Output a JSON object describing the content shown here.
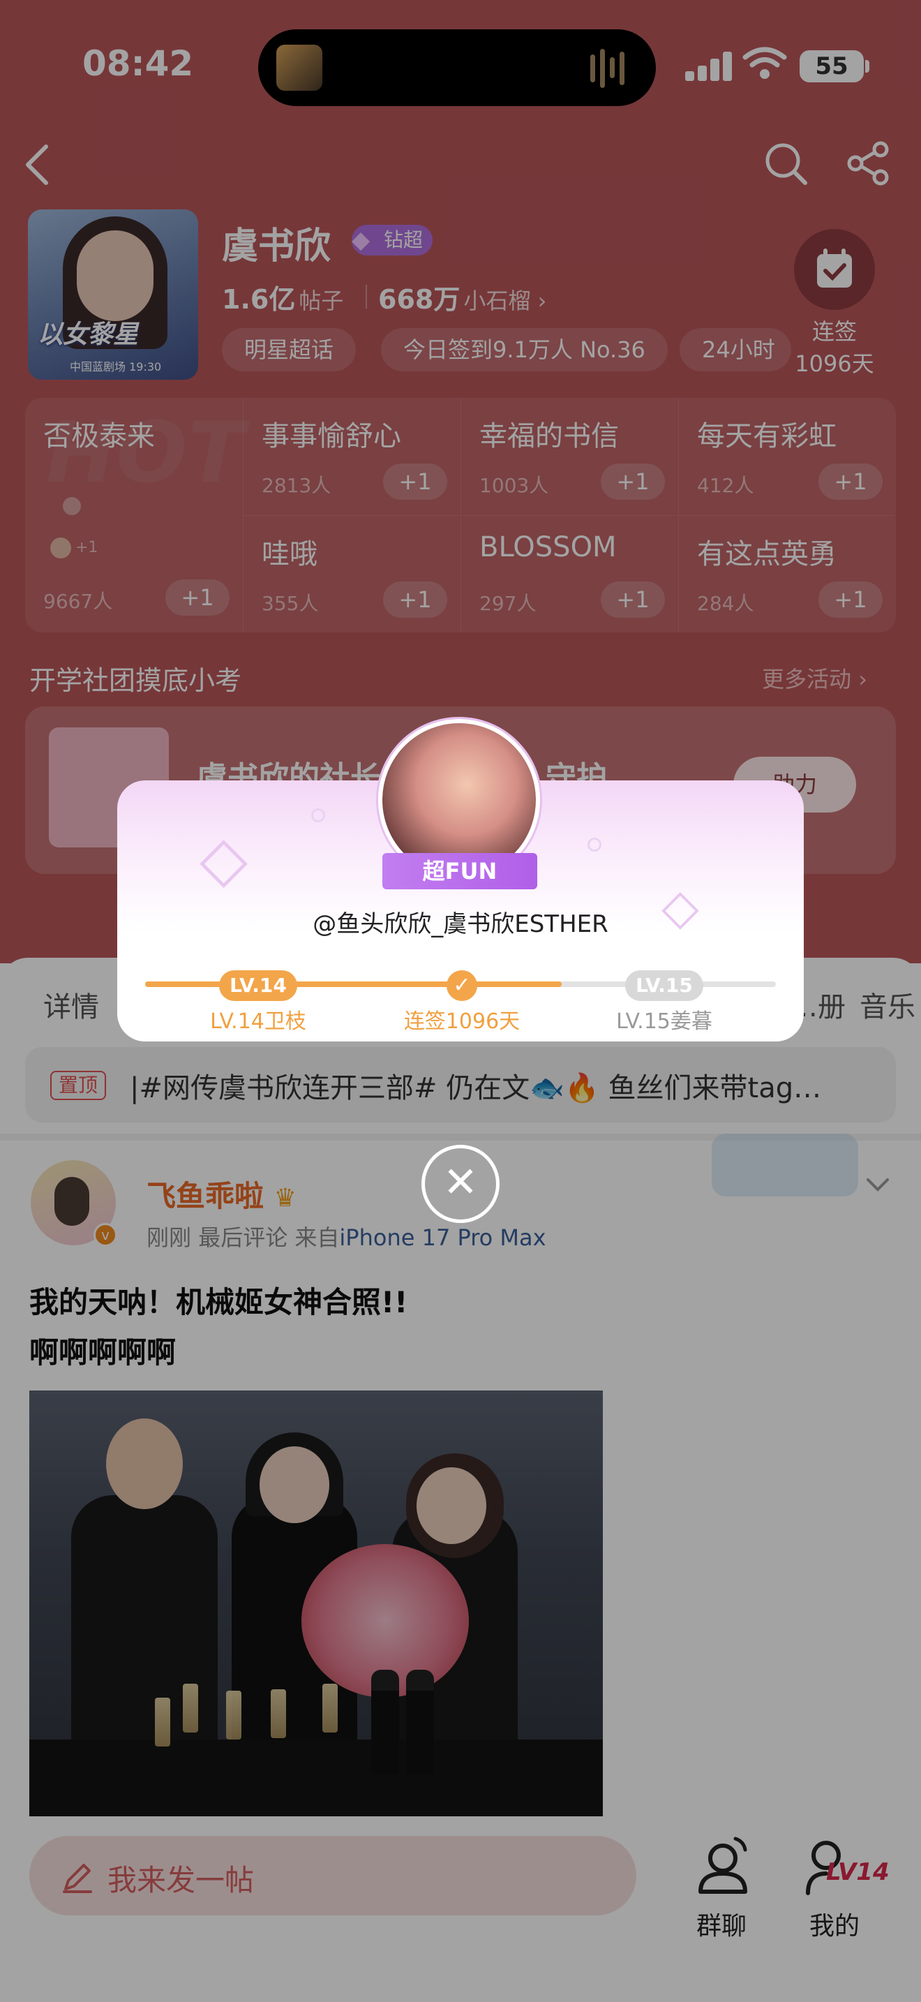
{
  "status_bar": {
    "time": "08:42",
    "battery": "55"
  },
  "topic": {
    "name": "虞书欣",
    "badge": "钻超",
    "avatar_caption": "中国蓝剧场 19:30"
  },
  "stats": {
    "posts_value": "1.6亿",
    "posts_label": "帖子",
    "fans_value": "668万",
    "fans_label": "小石榴"
  },
  "tags": [
    "明星超话",
    "今日签到9.1万人 No.36",
    "24小时"
  ],
  "checkin": {
    "label": "连签",
    "days": "1096天"
  },
  "groups": [
    {
      "name": "否极泰来",
      "count": "9667人",
      "plus": "+1"
    },
    {
      "name": "事事愉舒心",
      "count": "2813人",
      "plus": "+1"
    },
    {
      "name": "幸福的书信",
      "count": "1003人",
      "plus": "+1"
    },
    {
      "name": "每天有彩虹",
      "count": "412人",
      "plus": "+1"
    },
    {
      "name": "哇哦",
      "count": "355人",
      "plus": "+1"
    },
    {
      "name": "BLOSSOM",
      "count": "297人",
      "plus": "+1"
    },
    {
      "name": "有这点英勇",
      "count": "284人",
      "plus": "+1"
    }
  ],
  "activity": {
    "section_title": "开学社团摸底小考",
    "more": "更多活动",
    "title": "虞书欣的社长",
    "title_tail": "守护",
    "button": "助力"
  },
  "tabs": [
    "详情",
    "…册",
    "音乐"
  ],
  "pinned": {
    "label": "置顶",
    "text": "|#网传虞书欣连开三部# 仍在文🐟🔥 鱼丝们来带tag…"
  },
  "post": {
    "username": "飞鱼乖啦",
    "time": "刚刚",
    "sort": "最后评论",
    "from_label": "来自",
    "device": "iPhone 17 Pro Max",
    "line1": "我的天呐！机械姬女神合照!!",
    "line2": "啊啊啊啊啊"
  },
  "bottom": {
    "compose": "我来发一帖",
    "group_chat": "群聊",
    "mine": "我的",
    "mine_level": "LV14"
  },
  "modal": {
    "ribbon": "超FUN",
    "handle": "@鱼头欣欣_虞书欣ESTHER",
    "current_level": "LV.14",
    "current_caption": "LV.14卫枝",
    "streak_caption": "连签1096天",
    "next_level": "LV.15",
    "next_caption": "LV.15姜暮",
    "progress": 0.66
  },
  "colors": {
    "hero": "#b9565a",
    "accent_orange": "#f3a54a",
    "purple": "#b06fdf"
  }
}
